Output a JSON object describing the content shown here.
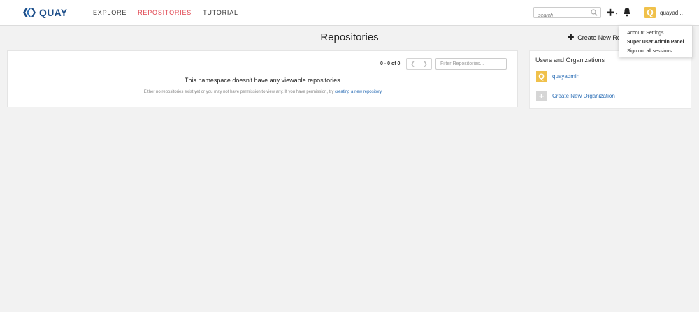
{
  "header": {
    "brand": "QUAY",
    "nav": [
      {
        "label": "EXPLORE",
        "active": false
      },
      {
        "label": "REPOSITORIES",
        "active": true
      },
      {
        "label": "TUTORIAL",
        "active": false
      }
    ],
    "search_placeholder": "search",
    "user": {
      "avatar_letter": "Q",
      "name": "quayad..."
    }
  },
  "dropdown": {
    "items": [
      "Account Settings",
      "Super User Admin Panel",
      "Sign out all sessions"
    ]
  },
  "page": {
    "title": "Repositories",
    "create_label": "Create New Re"
  },
  "repos": {
    "pager_count": "0 - 0 of 0",
    "filter_placeholder": "Filter Repositories...",
    "empty_title": "This namespace doesn't have any viewable repositories.",
    "empty_desc": "Either no repositories exist yet or you may not have permission to view any. If you have permission, try",
    "empty_link": "creating a new repository",
    "empty_end": "."
  },
  "orgs": {
    "title": "Users and Organizations",
    "items": [
      {
        "avatar_letter": "Q",
        "name": "quayadmin"
      }
    ],
    "create_label": "Create New Organization"
  },
  "colors": {
    "accent_red": "#e0424d",
    "brand_blue": "#1d4e89",
    "link_blue": "#2a6db5",
    "avatar_yellow": "#f0c14b"
  }
}
